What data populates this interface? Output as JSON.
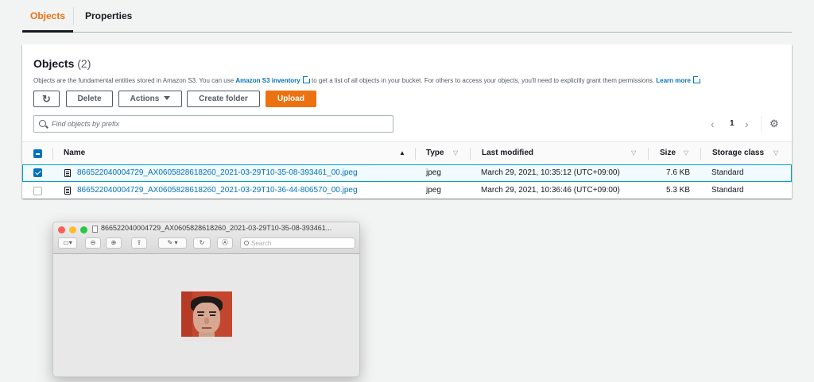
{
  "tabs": [
    {
      "label": "Objects",
      "active": true
    },
    {
      "label": "Properties",
      "active": false
    }
  ],
  "panel": {
    "title": "Objects",
    "count": "(2)",
    "desc_1": "Objects are the fundamental entities stored in Amazon S3. You can use ",
    "desc_link_1": "Amazon S3 inventory",
    "desc_2": " to get a list of all objects in your bucket. For others to access your objects, you'll need to explicitly grant them permissions. ",
    "desc_link_2": "Learn more"
  },
  "toolbar": {
    "refresh_icon": "↻",
    "delete_label": "Delete",
    "actions_label": "Actions",
    "create_folder_label": "Create folder",
    "upload_label": "Upload",
    "accent_color": "#ec7211"
  },
  "search": {
    "placeholder": "Find objects by prefix",
    "value": ""
  },
  "pagination": {
    "prev_icon": "‹",
    "page": "1",
    "next_icon": "›",
    "settings_icon": "⚙"
  },
  "table": {
    "columns": {
      "name": "Name",
      "type": "Type",
      "last_modified": "Last modified",
      "size": "Size",
      "storage_class": "Storage class"
    },
    "rows": [
      {
        "selected": true,
        "name": "866522040004729_AX0605828618260_2021-03-29T10-35-08-393461_00.jpeg",
        "type": "jpeg",
        "last_modified": "March 29, 2021, 10:35:12 (UTC+09:00)",
        "size": "7.6 KB",
        "storage_class": "Standard"
      },
      {
        "selected": false,
        "name": "866522040004729_AX0605828618260_2021-03-29T10-36-44-806570_00.jpeg",
        "type": "jpeg",
        "last_modified": "March 29, 2021, 10:36:46 (UTC+09:00)",
        "size": "5.3 KB",
        "storage_class": "Standard"
      }
    ]
  },
  "preview_window": {
    "title": "866522040004729_AX0605828618260_2021-03-29T10-35-08-393461...",
    "search_placeholder": "Search"
  }
}
